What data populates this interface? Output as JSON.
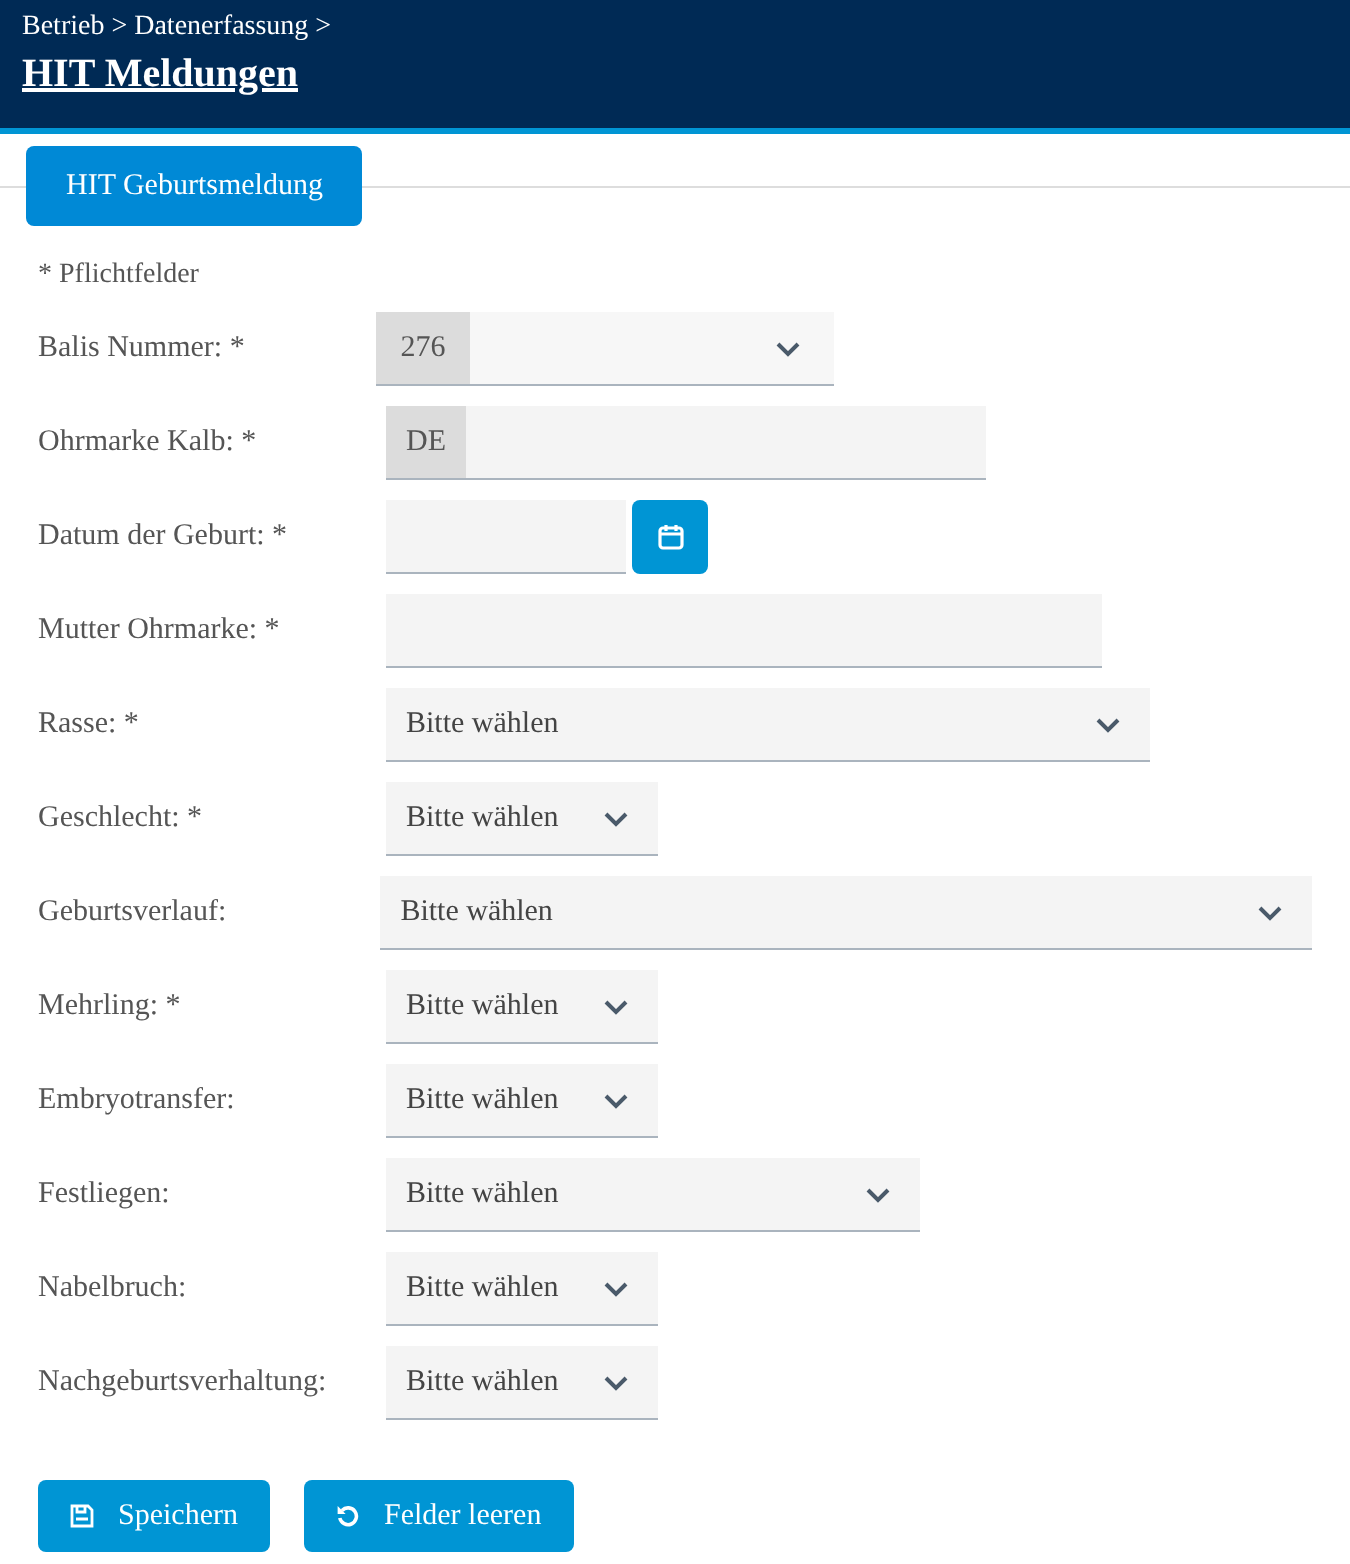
{
  "header": {
    "breadcrumb": "Betrieb > Datenerfassung >",
    "title": "HIT Meldungen"
  },
  "tabs": [
    {
      "label": "HIT Geburtsmeldung",
      "selected": true
    }
  ],
  "required_note": "* Pflichtfelder",
  "fields": [
    {
      "kind": "select-prefix",
      "label": "Balis Nummer: *",
      "prefix": "276"
    },
    {
      "kind": "text-prefix",
      "label": "Ohrmarke Kalb: *",
      "prefix": "DE"
    },
    {
      "kind": "date",
      "label": "Datum der Geburt: *"
    },
    {
      "kind": "text",
      "label": "Mutter Ohrmarke: *"
    },
    {
      "kind": "select",
      "label": "Rasse: *",
      "value": "Bitte wählen"
    },
    {
      "kind": "select",
      "label": "Geschlecht: *",
      "value": "Bitte wählen"
    },
    {
      "kind": "select",
      "label": "Geburtsverlauf:",
      "value": "Bitte wählen"
    },
    {
      "kind": "select",
      "label": "Mehrling: *",
      "value": "Bitte wählen"
    },
    {
      "kind": "select",
      "label": "Embryotransfer:",
      "value": "Bitte wählen"
    },
    {
      "kind": "select",
      "label": "Festliegen:",
      "value": "Bitte wählen"
    },
    {
      "kind": "select",
      "label": "Nabelbruch:",
      "value": "Bitte wählen"
    },
    {
      "kind": "select",
      "label": "Nachgeburtsverhaltung:",
      "value": "Bitte wählen"
    }
  ],
  "buttons": [
    {
      "kind": "save",
      "label": "Speichern"
    },
    {
      "kind": "reset",
      "label": "Felder leeren"
    }
  ]
}
